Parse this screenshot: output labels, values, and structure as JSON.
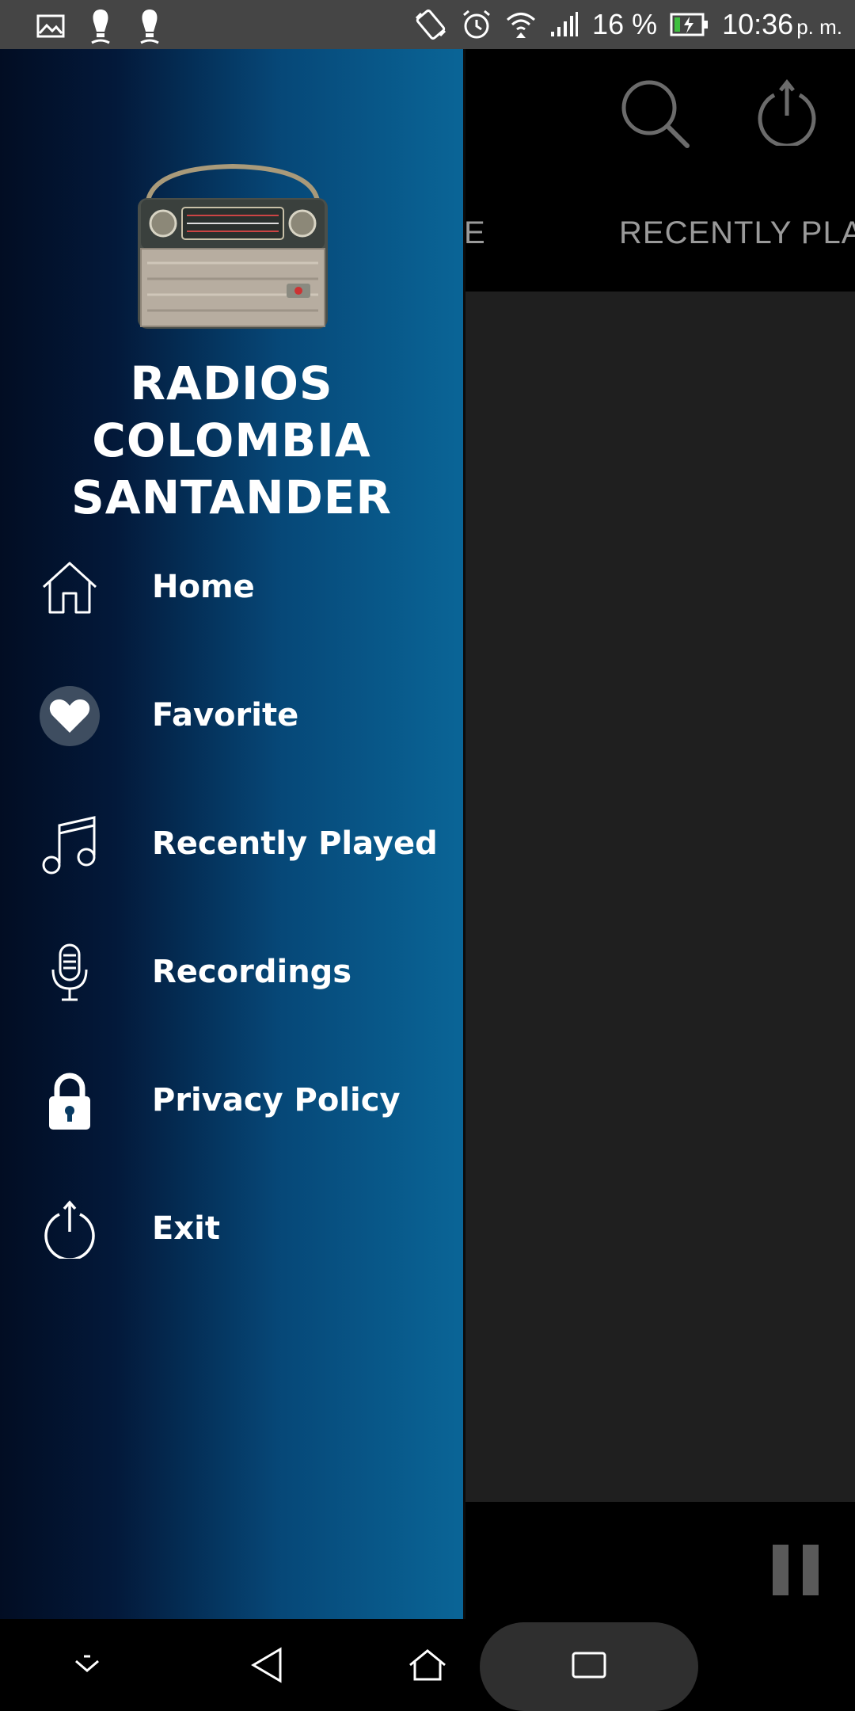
{
  "status_bar": {
    "battery_percent": "16 %",
    "time": "10:36",
    "time_suffix": "p. m.",
    "icons": [
      "gallery-icon",
      "notification-icon",
      "notification-icon",
      "vibrate-icon",
      "alarm-icon",
      "wifi-icon",
      "signal-icon",
      "battery-icon"
    ]
  },
  "app": {
    "tabs": [
      {
        "label": "E"
      },
      {
        "label": "RECENTLY PLA"
      }
    ],
    "actions": [
      "search-icon",
      "power-icon"
    ]
  },
  "drawer": {
    "title_lines": [
      "RADIOS",
      "COLOMBIA",
      "SANTANDER"
    ],
    "items": [
      {
        "label": "Home",
        "icon": "home-icon"
      },
      {
        "label": "Favorite",
        "icon": "heart-icon"
      },
      {
        "label": "Recently Played",
        "icon": "music-note-icon"
      },
      {
        "label": "Recordings",
        "icon": "microphone-icon"
      },
      {
        "label": "Privacy Policy",
        "icon": "lock-icon"
      },
      {
        "label": "Exit",
        "icon": "power-icon"
      }
    ]
  },
  "navigation": [
    "chevron-down-icon",
    "back-icon",
    "home-icon",
    "recents-icon"
  ],
  "colors": {
    "drawer_gradient_start": "#020d23",
    "drawer_gradient_end": "#0a6597",
    "status_bar": "#454545",
    "content_bg": "#1f1f1f"
  }
}
